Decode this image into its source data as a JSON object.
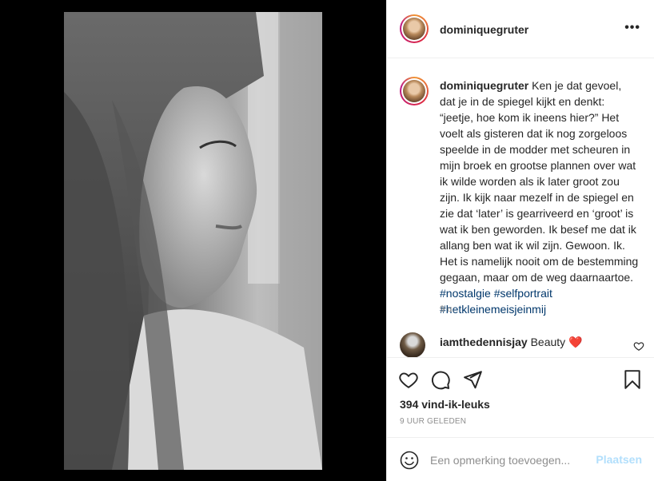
{
  "post": {
    "username": "dominiquegruter",
    "more_icon": "more-horizontal-icon",
    "caption": {
      "username": "dominiquegruter",
      "text": "Ken je dat gevoel, dat je in de spiegel kijkt en denkt: “jeetje, hoe kom ik ineens hier?” Het voelt als gisteren dat ik nog zorgeloos speelde in de modder met scheuren in mijn broek en grootse plannen over wat ik wilde worden als ik later groot zou zijn. Ik kijk naar mezelf in de spiegel en zie dat ‘later’ is gearriveerd en ‘groot’ is wat ik ben geworden. Ik besef me dat ik allang ben wat ik wil zijn. Gewoon. Ik. Het is namelijk nooit om de bestemming gegaan, maar om de weg daarnaartoe.",
      "hashtags": [
        "#nostalgie",
        "#selfportrait",
        "#hetkleinemeisjeinmij"
      ],
      "time": "9 u."
    },
    "comments": [
      {
        "username": "iamthedennisjay",
        "text": "Beauty",
        "emoji": "❤️"
      }
    ],
    "likes": "394 vind-ik-leuks",
    "time_ago": "9 UUR GELEDEN",
    "add_comment": {
      "placeholder": "Een opmerking toevoegen...",
      "post_label": "Plaatsen"
    }
  },
  "icons": {
    "like": "heart-outline-icon",
    "comment": "speech-bubble-icon",
    "share": "paper-plane-icon",
    "save": "bookmark-icon",
    "emoji": "smiley-icon"
  },
  "colors": {
    "hashtag": "#00376b",
    "muted": "#8e8e8e",
    "post_disabled": "#b2dffc",
    "heart": "#ed4956"
  }
}
